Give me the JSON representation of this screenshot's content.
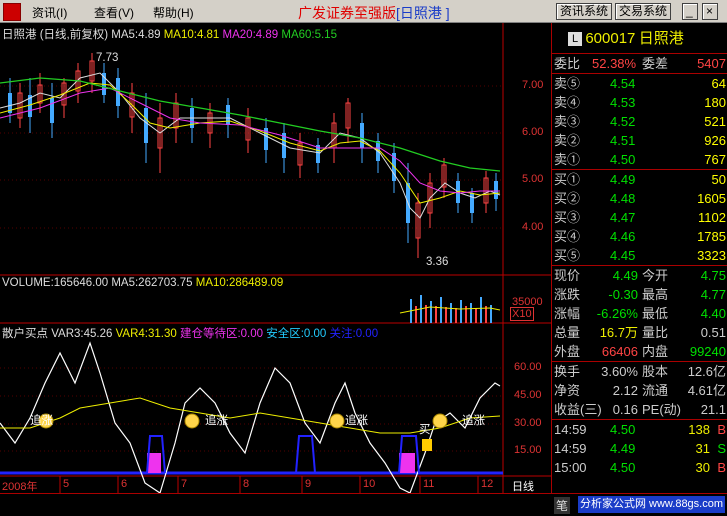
{
  "menu": {
    "items": [
      "资讯(I)",
      "查看(V)",
      "帮助(H)"
    ],
    "title_prefix": "广发证券至强版",
    "title_code": "[日照港 ]",
    "btn_news": "资讯系统",
    "btn_trade": "交易系统"
  },
  "main_chart": {
    "title": "日照港 (日线,前复权)",
    "ma5": "MA5:4.89",
    "ma10": "MA10:4.81",
    "ma20": "MA20:4.89",
    "ma60": "MA60:5.15",
    "high_label": "7.73",
    "low_label": "3.36",
    "price_axis": [
      "7.00",
      "6.00",
      "5.00",
      "4.00"
    ]
  },
  "volume_chart": {
    "vol": "VOLUME:165646.00",
    "ma5": "MA5:262703.75",
    "ma10": "MA10:286489.09",
    "axis": "35000",
    "x10": "X10"
  },
  "indicator_chart": {
    "name": "散户买点",
    "var3": "VAR3:45.26",
    "var4": "VAR4:31.30",
    "zone1": "建仓等待区:0.00",
    "zone2": "安全区:0.00",
    "zone3": "关注:0.00",
    "signal_chase": "追涨",
    "signal_buy": "买",
    "axis": [
      "60.00",
      "45.00",
      "30.00",
      "15.00"
    ]
  },
  "x_axis": {
    "labels": [
      "2008年",
      "5",
      "6",
      "7",
      "8",
      "9",
      "10",
      "11",
      "12"
    ],
    "period": "日线"
  },
  "quote": {
    "code": "600017",
    "name": "日照港",
    "weibi_label": "委比",
    "weibi": "52.38%",
    "weicha_label": "委差",
    "weicha": "5407",
    "sells": [
      {
        "label": "卖⑤",
        "price": "4.54",
        "vol": "64"
      },
      {
        "label": "卖④",
        "price": "4.53",
        "vol": "180"
      },
      {
        "label": "卖③",
        "price": "4.52",
        "vol": "521"
      },
      {
        "label": "卖②",
        "price": "4.51",
        "vol": "926"
      },
      {
        "label": "卖①",
        "price": "4.50",
        "vol": "767"
      }
    ],
    "buys": [
      {
        "label": "买①",
        "price": "4.49",
        "vol": "50"
      },
      {
        "label": "买②",
        "price": "4.48",
        "vol": "1605"
      },
      {
        "label": "买③",
        "price": "4.47",
        "vol": "1102"
      },
      {
        "label": "买④",
        "price": "4.46",
        "vol": "1785"
      },
      {
        "label": "买⑤",
        "price": "4.45",
        "vol": "3323"
      }
    ],
    "stats": [
      {
        "l1": "现价",
        "v1": "4.49",
        "l2": "今开",
        "v2": "4.75"
      },
      {
        "l1": "涨跌",
        "v1": "-0.30",
        "l2": "最高",
        "v2": "4.77"
      },
      {
        "l1": "涨幅",
        "v1": "-6.26%",
        "l2": "最低",
        "v2": "4.40"
      },
      {
        "l1": "总量",
        "v1": "16.7万",
        "l2": "量比",
        "v2": "0.51"
      },
      {
        "l1": "外盘",
        "v1": "66406",
        "l2": "内盘",
        "v2": "99240"
      }
    ],
    "fund": [
      {
        "l1": "换手",
        "v1": "3.60%",
        "l2": "股本",
        "v2": "12.6亿"
      },
      {
        "l1": "净资",
        "v1": "2.12",
        "l2": "流通",
        "v2": "4.61亿"
      },
      {
        "l1": "收益(三)",
        "v1": "0.16",
        "l2": "PE(动)",
        "v2": "21.1"
      }
    ],
    "ticks": [
      {
        "time": "14:59",
        "price": "4.50",
        "vol": "138",
        "side": "B"
      },
      {
        "time": "14:59",
        "price": "4.49",
        "vol": "31",
        "side": "S"
      },
      {
        "time": "15:00",
        "price": "4.50",
        "vol": "30",
        "side": "B"
      }
    ]
  },
  "bottom": {
    "tab": "笔",
    "watermark": "分析家公式网 www.88gs.com"
  }
}
